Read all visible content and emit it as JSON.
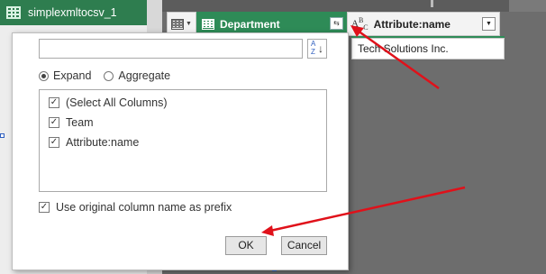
{
  "queries": {
    "items": [
      {
        "label": "simplexmltocsv_1",
        "icon": "table-icon"
      }
    ]
  },
  "grid": {
    "columns": [
      {
        "label": "Department",
        "type_icon": "table-icon",
        "action_icon": "expand-icon",
        "selected": true
      },
      {
        "label": "Attribute:name",
        "type_icon": "abc-text-icon",
        "action_icon": "chevron-down-icon"
      }
    ],
    "rows": [
      {
        "attribute_name": "Tech Solutions Inc."
      }
    ],
    "accent_color": "#2e8b57"
  },
  "dialog": {
    "search": {
      "value": "",
      "placeholder": ""
    },
    "sort_icon": "sort-az-icon",
    "sort_letters": "A Z",
    "mode_options": [
      {
        "label": "Expand",
        "selected": true
      },
      {
        "label": "Aggregate",
        "selected": false
      }
    ],
    "columns": [
      {
        "label": "(Select All Columns)",
        "checked": true
      },
      {
        "label": "Team",
        "checked": true
      },
      {
        "label": "Attribute:name",
        "checked": true
      }
    ],
    "use_prefix": {
      "label": "Use original column name as prefix",
      "checked": true
    },
    "ok_label": "OK",
    "cancel_label": "Cancel"
  },
  "annotation": {
    "color": "#e0111a",
    "arrows": [
      "points-to-expand-button",
      "points-to-ok-button"
    ]
  }
}
